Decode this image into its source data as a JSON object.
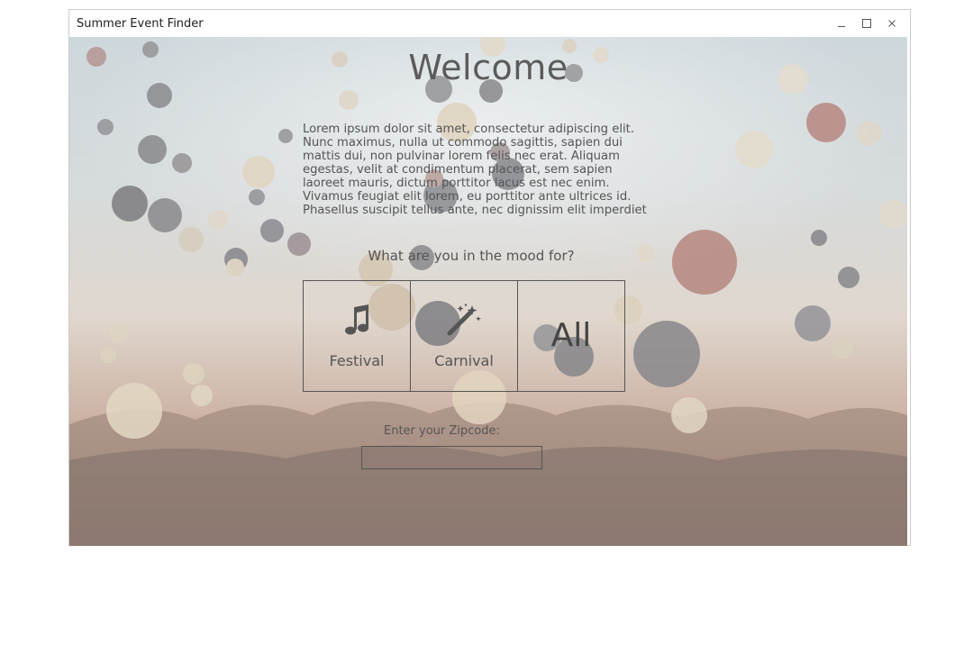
{
  "window": {
    "title": "Summer Event Finder",
    "controls": [
      "minimize-icon",
      "maximize-icon",
      "close-icon"
    ]
  },
  "main": {
    "heading": "Welcome",
    "intro": "Lorem ipsum dolor sit amet, consectetur adipiscing elit. Nunc maximus, nulla ut commodo sagittis, sapien dui mattis dui, non pulvinar lorem felis nec erat. Aliquam egestas, velit at condimentum placerat, sem sapien laoreet mauris, dictum porttitor lacus est nec enim. Vivamus feugiat elit lorem, eu porttitor ante ultrices id. Phasellus suscipit tellus ante, nec dignissim elit imperdiet nec. Nullam",
    "mood_prompt": "What are you in the mood for?",
    "mood_options": [
      {
        "label": "Festival",
        "icon": "music-note-icon"
      },
      {
        "label": "Carnival",
        "icon": "magic-wand-icon"
      },
      {
        "label": "All",
        "icon": ""
      }
    ],
    "zipcode": {
      "label": "Enter your Zipcode:",
      "value": "",
      "placeholder": ""
    }
  },
  "colors": {
    "text": "#555555",
    "border": "#555555",
    "background_top": "#bcc9cf",
    "background_bottom": "#7e5d4c"
  }
}
